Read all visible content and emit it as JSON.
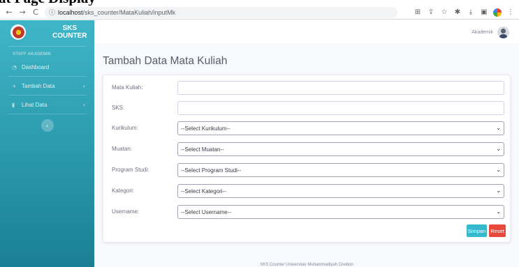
{
  "document": {
    "title": "at Page Display"
  },
  "browser": {
    "address_host": "localhost",
    "address_path": "/sks_counter/MataKuliah/inputMk"
  },
  "sidebar": {
    "brand_line1": "SKS",
    "brand_line2": "COUNTER",
    "heading": "STAFF AKADEMIK",
    "items": [
      {
        "label": "Dashboard",
        "icon": "dashboard-icon"
      },
      {
        "label": "Tambah Data",
        "icon": "plus-icon"
      },
      {
        "label": "Lihat Data",
        "icon": "file-icon"
      }
    ],
    "colors": {
      "top": "#3fb6c8",
      "bottom": "#1b7f93"
    }
  },
  "topbar": {
    "user": "Akademik"
  },
  "main": {
    "title": "Tambah Data Mata Kuliah"
  },
  "form": {
    "fields": [
      {
        "label": "Mata Kuliah:",
        "type": "text",
        "value": ""
      },
      {
        "label": "SKS:",
        "type": "text",
        "value": ""
      },
      {
        "label": "Kurikulum:",
        "type": "select",
        "value": "--Select Kurikulum--"
      },
      {
        "label": "Muatan:",
        "type": "select",
        "value": "--Select Muatan--"
      },
      {
        "label": "Program Studi:",
        "type": "select",
        "value": "--Select Program Studi--"
      },
      {
        "label": "Kategori:",
        "type": "select",
        "value": "--Select Kategori--"
      },
      {
        "label": "Username:",
        "type": "select",
        "value": "--Select Username--"
      }
    ],
    "buttons": {
      "save": "Simpan",
      "reset": "Reset"
    },
    "colors": {
      "save": "#36b9cc",
      "reset": "#e74a3b"
    }
  },
  "footer": {
    "text": "SKS Counter Universitas Muhammadiyah Cirebon"
  }
}
